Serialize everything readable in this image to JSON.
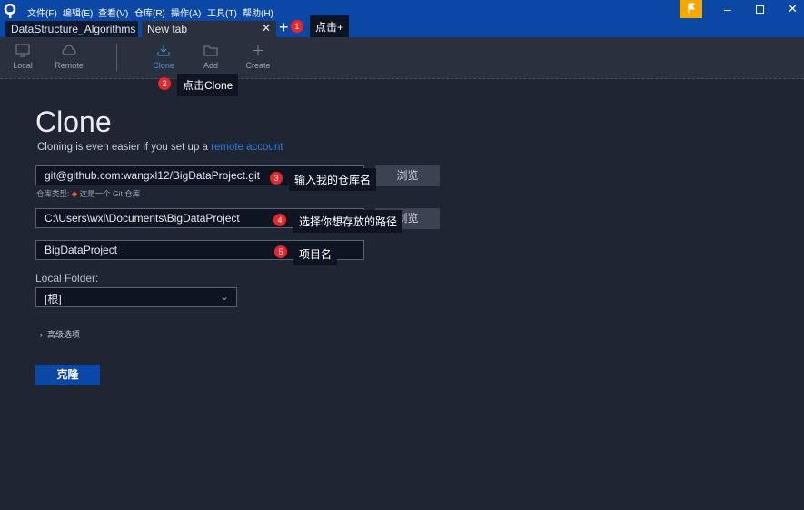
{
  "menu": [
    "文件(F)",
    "编辑(E)",
    "查看(V)",
    "仓库(R)",
    "操作(A)",
    "工具(T)",
    "帮助(H)"
  ],
  "tabs": [
    {
      "label": "DataStructure_Algorithms"
    },
    {
      "label": "New tab"
    }
  ],
  "toolbar": {
    "local": "Local",
    "remote": "Remote",
    "clone": "Clone",
    "add": "Add",
    "create": "Create"
  },
  "annotations": [
    {
      "num": "1",
      "text": "点击+"
    },
    {
      "num": "2",
      "text": "点击Clone"
    },
    {
      "num": "3",
      "text": "输入我的仓库名"
    },
    {
      "num": "4",
      "text": "选择你想存放的路径"
    },
    {
      "num": "5",
      "text": "项目名"
    }
  ],
  "clone": {
    "title": "Clone",
    "subtitle": "Cloning is even easier if you set up a",
    "subtitle_link": "remote account",
    "url_value": "git@github.com:wangxl12/BigDataProject.git",
    "browse": "浏览",
    "repo_type_label": "仓库类型:",
    "repo_type_value": "这是一个 Git 仓库",
    "path_value": "C:\\Users\\wxl\\Documents\\BigDataProject",
    "name_value": "BigDataProject",
    "local_folder_label": "Local Folder:",
    "local_folder_value": "[根]",
    "advanced": "高级选项",
    "submit": "克隆"
  },
  "colors": {
    "accent": "#0b47a5",
    "link": "#2f7fd6",
    "badge": "#e8262c",
    "flag": "#f5a800"
  }
}
